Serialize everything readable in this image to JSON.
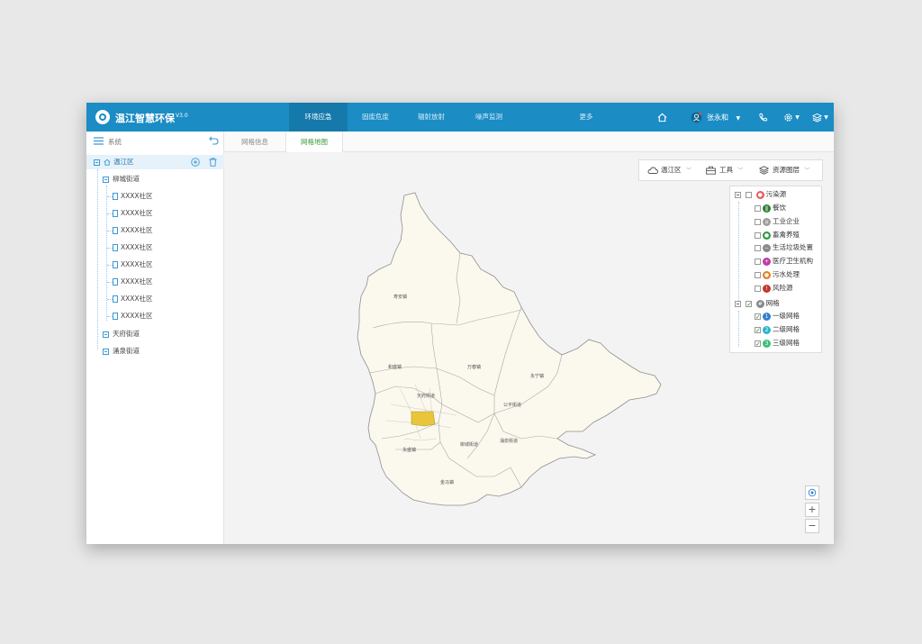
{
  "app": {
    "title": "温江智慧环保",
    "version": "V3.0"
  },
  "nav": {
    "tabs": [
      {
        "label": "环境应急",
        "active": true
      },
      {
        "label": "固废危废",
        "active": false
      },
      {
        "label": "辐射放射",
        "active": false
      },
      {
        "label": "噪声监测",
        "active": false
      },
      {
        "label": "更多",
        "active": false
      }
    ],
    "user_name": "张永和"
  },
  "sidebar": {
    "title": "系统",
    "root": "温江区",
    "streets": [
      {
        "label": "柳城街道",
        "expanded": true,
        "communities": [
          "XXXX社区",
          "XXXX社区",
          "XXXX社区",
          "XXXX社区",
          "XXXX社区",
          "XXXX社区",
          "XXXX社区",
          "XXXX社区"
        ]
      },
      {
        "label": "天府街道",
        "expanded": false
      },
      {
        "label": "涌泉街道",
        "expanded": false
      }
    ]
  },
  "main": {
    "tabs": [
      {
        "label": "网格信息",
        "active": false
      },
      {
        "label": "网格地图",
        "active": true
      }
    ]
  },
  "map": {
    "toolbar": {
      "district": "温江区",
      "tools": "工具",
      "layers": "资源图层"
    },
    "towns": [
      "寿安镇",
      "和盛镇",
      "万春镇",
      "永宁镇",
      "公平街道",
      "天府街道",
      "永盛镇",
      "柳城街道",
      "涌泉街道",
      "金马镇"
    ],
    "highlight_color": "#e8c53a",
    "region_fill": "#fbf8ee"
  },
  "legend": {
    "groups": [
      {
        "label": "污染源",
        "checked": false,
        "color": "#e85b5b",
        "items": [
          {
            "label": "餐饮",
            "checked": false,
            "color": "#2e7d32",
            "icon": "restaurant-icon"
          },
          {
            "label": "工业企业",
            "checked": false,
            "color": "#9e9e9e",
            "icon": "factory-icon"
          },
          {
            "label": "畜禽养殖",
            "checked": false,
            "color": "#2e9a3e",
            "icon": "livestock-icon"
          },
          {
            "label": "生活垃圾处置",
            "checked": false,
            "color": "#8a8a8a",
            "icon": "garbage-icon"
          },
          {
            "label": "医疗卫生机构",
            "checked": false,
            "color": "#c03aa8",
            "icon": "medical-icon"
          },
          {
            "label": "污水处理",
            "checked": false,
            "color": "#e67e22",
            "icon": "sewage-icon"
          },
          {
            "label": "风险源",
            "checked": false,
            "color": "#c0392b",
            "icon": "risk-icon"
          }
        ]
      },
      {
        "label": "网格",
        "checked": true,
        "color": "#888888",
        "items": [
          {
            "label": "一级网格",
            "checked": true,
            "color": "#2f80d1",
            "badge": "1"
          },
          {
            "label": "二级网格",
            "checked": true,
            "color": "#2bb5c9",
            "badge": "2"
          },
          {
            "label": "三级网格",
            "checked": true,
            "color": "#3bbf7a",
            "badge": "3"
          }
        ]
      }
    ]
  }
}
